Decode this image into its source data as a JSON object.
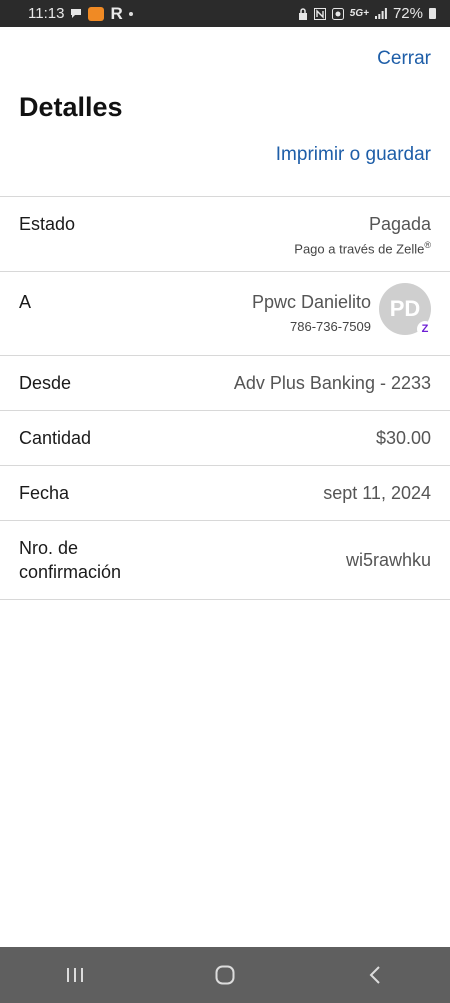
{
  "status_bar": {
    "time": "11:13",
    "network": "5G+",
    "battery": "72%"
  },
  "header": {
    "close_label": "Cerrar",
    "title": "Detalles",
    "print_label": "Imprimir o guardar"
  },
  "details": {
    "estado": {
      "label": "Estado",
      "value": "Pagada",
      "sub": "Pago a través de Zelle"
    },
    "a": {
      "label": "A",
      "name": "Ppwc Danielito",
      "phone": "786-736-7509",
      "initials": "PD"
    },
    "desde": {
      "label": "Desde",
      "value": "Adv Plus Banking - 2233"
    },
    "cantidad": {
      "label": "Cantidad",
      "value": "$30.00"
    },
    "fecha": {
      "label": "Fecha",
      "value": "sept 11, 2024"
    },
    "confirmacion": {
      "label_line1": "Nro. de",
      "label_line2": "confirmación",
      "value": "wi5rawhku"
    }
  },
  "colors": {
    "link": "#1e5ea8",
    "zelle": "#6d1ed4",
    "nav_bar": "#5f5f5f",
    "status_bar": "#2b2b2b"
  },
  "icons": {
    "nav_recents": "recents-icon",
    "nav_home": "home-icon",
    "nav_back": "back-icon"
  }
}
